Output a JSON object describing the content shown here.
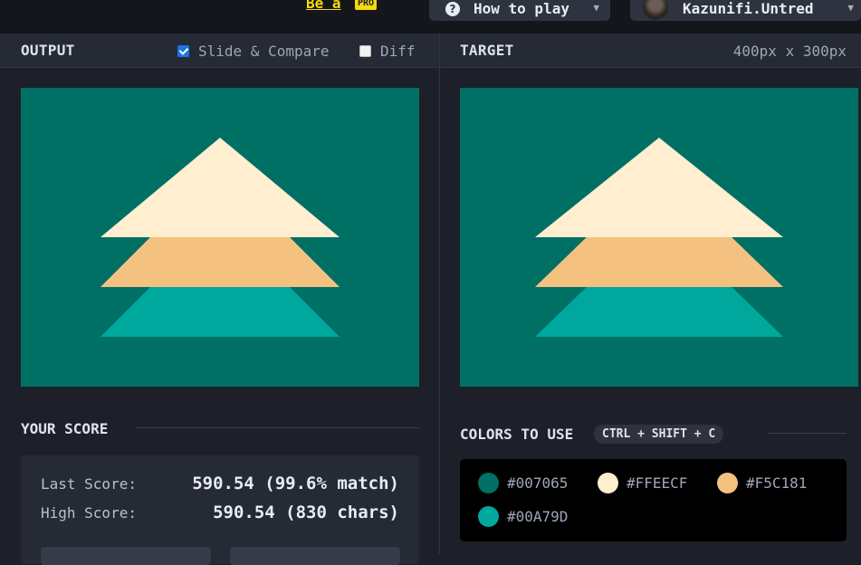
{
  "topbar": {
    "be_a": "Be a",
    "pro": "PRO",
    "how_to_play": "How to play",
    "username": "Kazunifi.Untred",
    "help_icon": "question-circle-icon",
    "caret_icon": "caret-down-icon"
  },
  "output": {
    "title": "OUTPUT",
    "slide_compare": "Slide & Compare",
    "slide_compare_checked": true,
    "diff": "Diff",
    "diff_checked": false
  },
  "target": {
    "title": "TARGET",
    "dimensions": "400px x 300px"
  },
  "score": {
    "title": "YOUR SCORE",
    "last_label": "Last Score:",
    "last_value": "590.54 (99.6% match)",
    "high_label": "High Score:",
    "high_value": "590.54 (830 chars)"
  },
  "colors": {
    "title": "COLORS TO USE",
    "shortcut": "CTRL + SHIFT + C",
    "items": [
      {
        "hex": "#007065",
        "label": "#007065"
      },
      {
        "hex": "#FFEECF",
        "label": "#FFEECF"
      },
      {
        "hex": "#F5C181",
        "label": "#F5C181"
      },
      {
        "hex": "#00A79D",
        "label": "#00A79D"
      }
    ]
  },
  "palette": {
    "background": "#007065",
    "top": "#FFEECF",
    "middle": "#F5C181",
    "bottom": "#00A79D"
  }
}
